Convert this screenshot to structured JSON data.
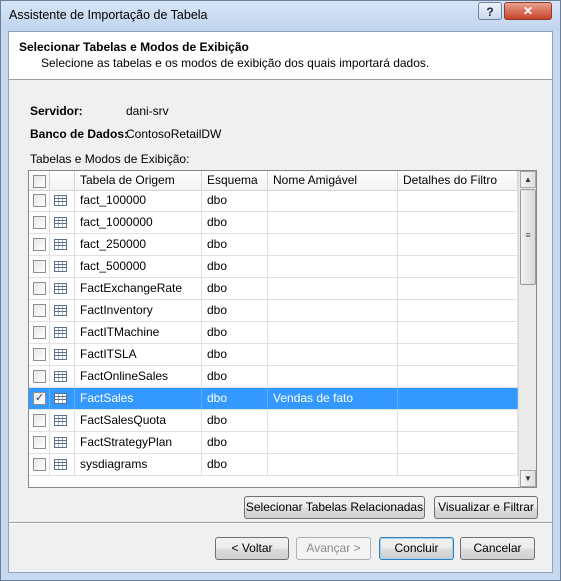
{
  "window": {
    "title": "Assistente de Importação de Tabela",
    "help_label": "?",
    "close_label": "✕"
  },
  "header": {
    "title": "Selecionar Tabelas e Modos de Exibição",
    "subtitle": "Selecione as tabelas e os modos de exibição dos quais importará dados."
  },
  "server": {
    "label": "Servidor:",
    "value": "dani-srv"
  },
  "database": {
    "label": "Banco de Dados:",
    "value": "ContosoRetailDW"
  },
  "grid": {
    "label": "Tabelas e Modos de Exibição:",
    "columns": [
      "Tabela de Origem",
      "Esquema",
      "Nome Amigável",
      "Detalhes do Filtro"
    ],
    "rows": [
      {
        "name": "fact_100000",
        "schema": "dbo",
        "friendly": "",
        "filter": "",
        "checked": false
      },
      {
        "name": "fact_1000000",
        "schema": "dbo",
        "friendly": "",
        "filter": "",
        "checked": false
      },
      {
        "name": "fact_250000",
        "schema": "dbo",
        "friendly": "",
        "filter": "",
        "checked": false
      },
      {
        "name": "fact_500000",
        "schema": "dbo",
        "friendly": "",
        "filter": "",
        "checked": false
      },
      {
        "name": "FactExchangeRate",
        "schema": "dbo",
        "friendly": "",
        "filter": "",
        "checked": false
      },
      {
        "name": "FactInventory",
        "schema": "dbo",
        "friendly": "",
        "filter": "",
        "checked": false
      },
      {
        "name": "FactITMachine",
        "schema": "dbo",
        "friendly": "",
        "filter": "",
        "checked": false
      },
      {
        "name": "FactITSLA",
        "schema": "dbo",
        "friendly": "",
        "filter": "",
        "checked": false
      },
      {
        "name": "FactOnlineSales",
        "schema": "dbo",
        "friendly": "",
        "filter": "",
        "checked": false
      },
      {
        "name": "FactSales",
        "schema": "dbo",
        "friendly": "Vendas de fato",
        "filter": "",
        "checked": true,
        "selected": true
      },
      {
        "name": "FactSalesQuota",
        "schema": "dbo",
        "friendly": "",
        "filter": "",
        "checked": false
      },
      {
        "name": "FactStrategyPlan",
        "schema": "dbo",
        "friendly": "",
        "filter": "",
        "checked": false
      },
      {
        "name": "sysdiagrams",
        "schema": "dbo",
        "friendly": "",
        "filter": "",
        "checked": false
      }
    ]
  },
  "buttons": {
    "related": "Selecionar Tabelas Relacionadas",
    "preview": "Visualizar e Filtrar",
    "back": "< Voltar",
    "next": "Avançar >",
    "finish": "Concluir",
    "cancel": "Cancelar"
  }
}
